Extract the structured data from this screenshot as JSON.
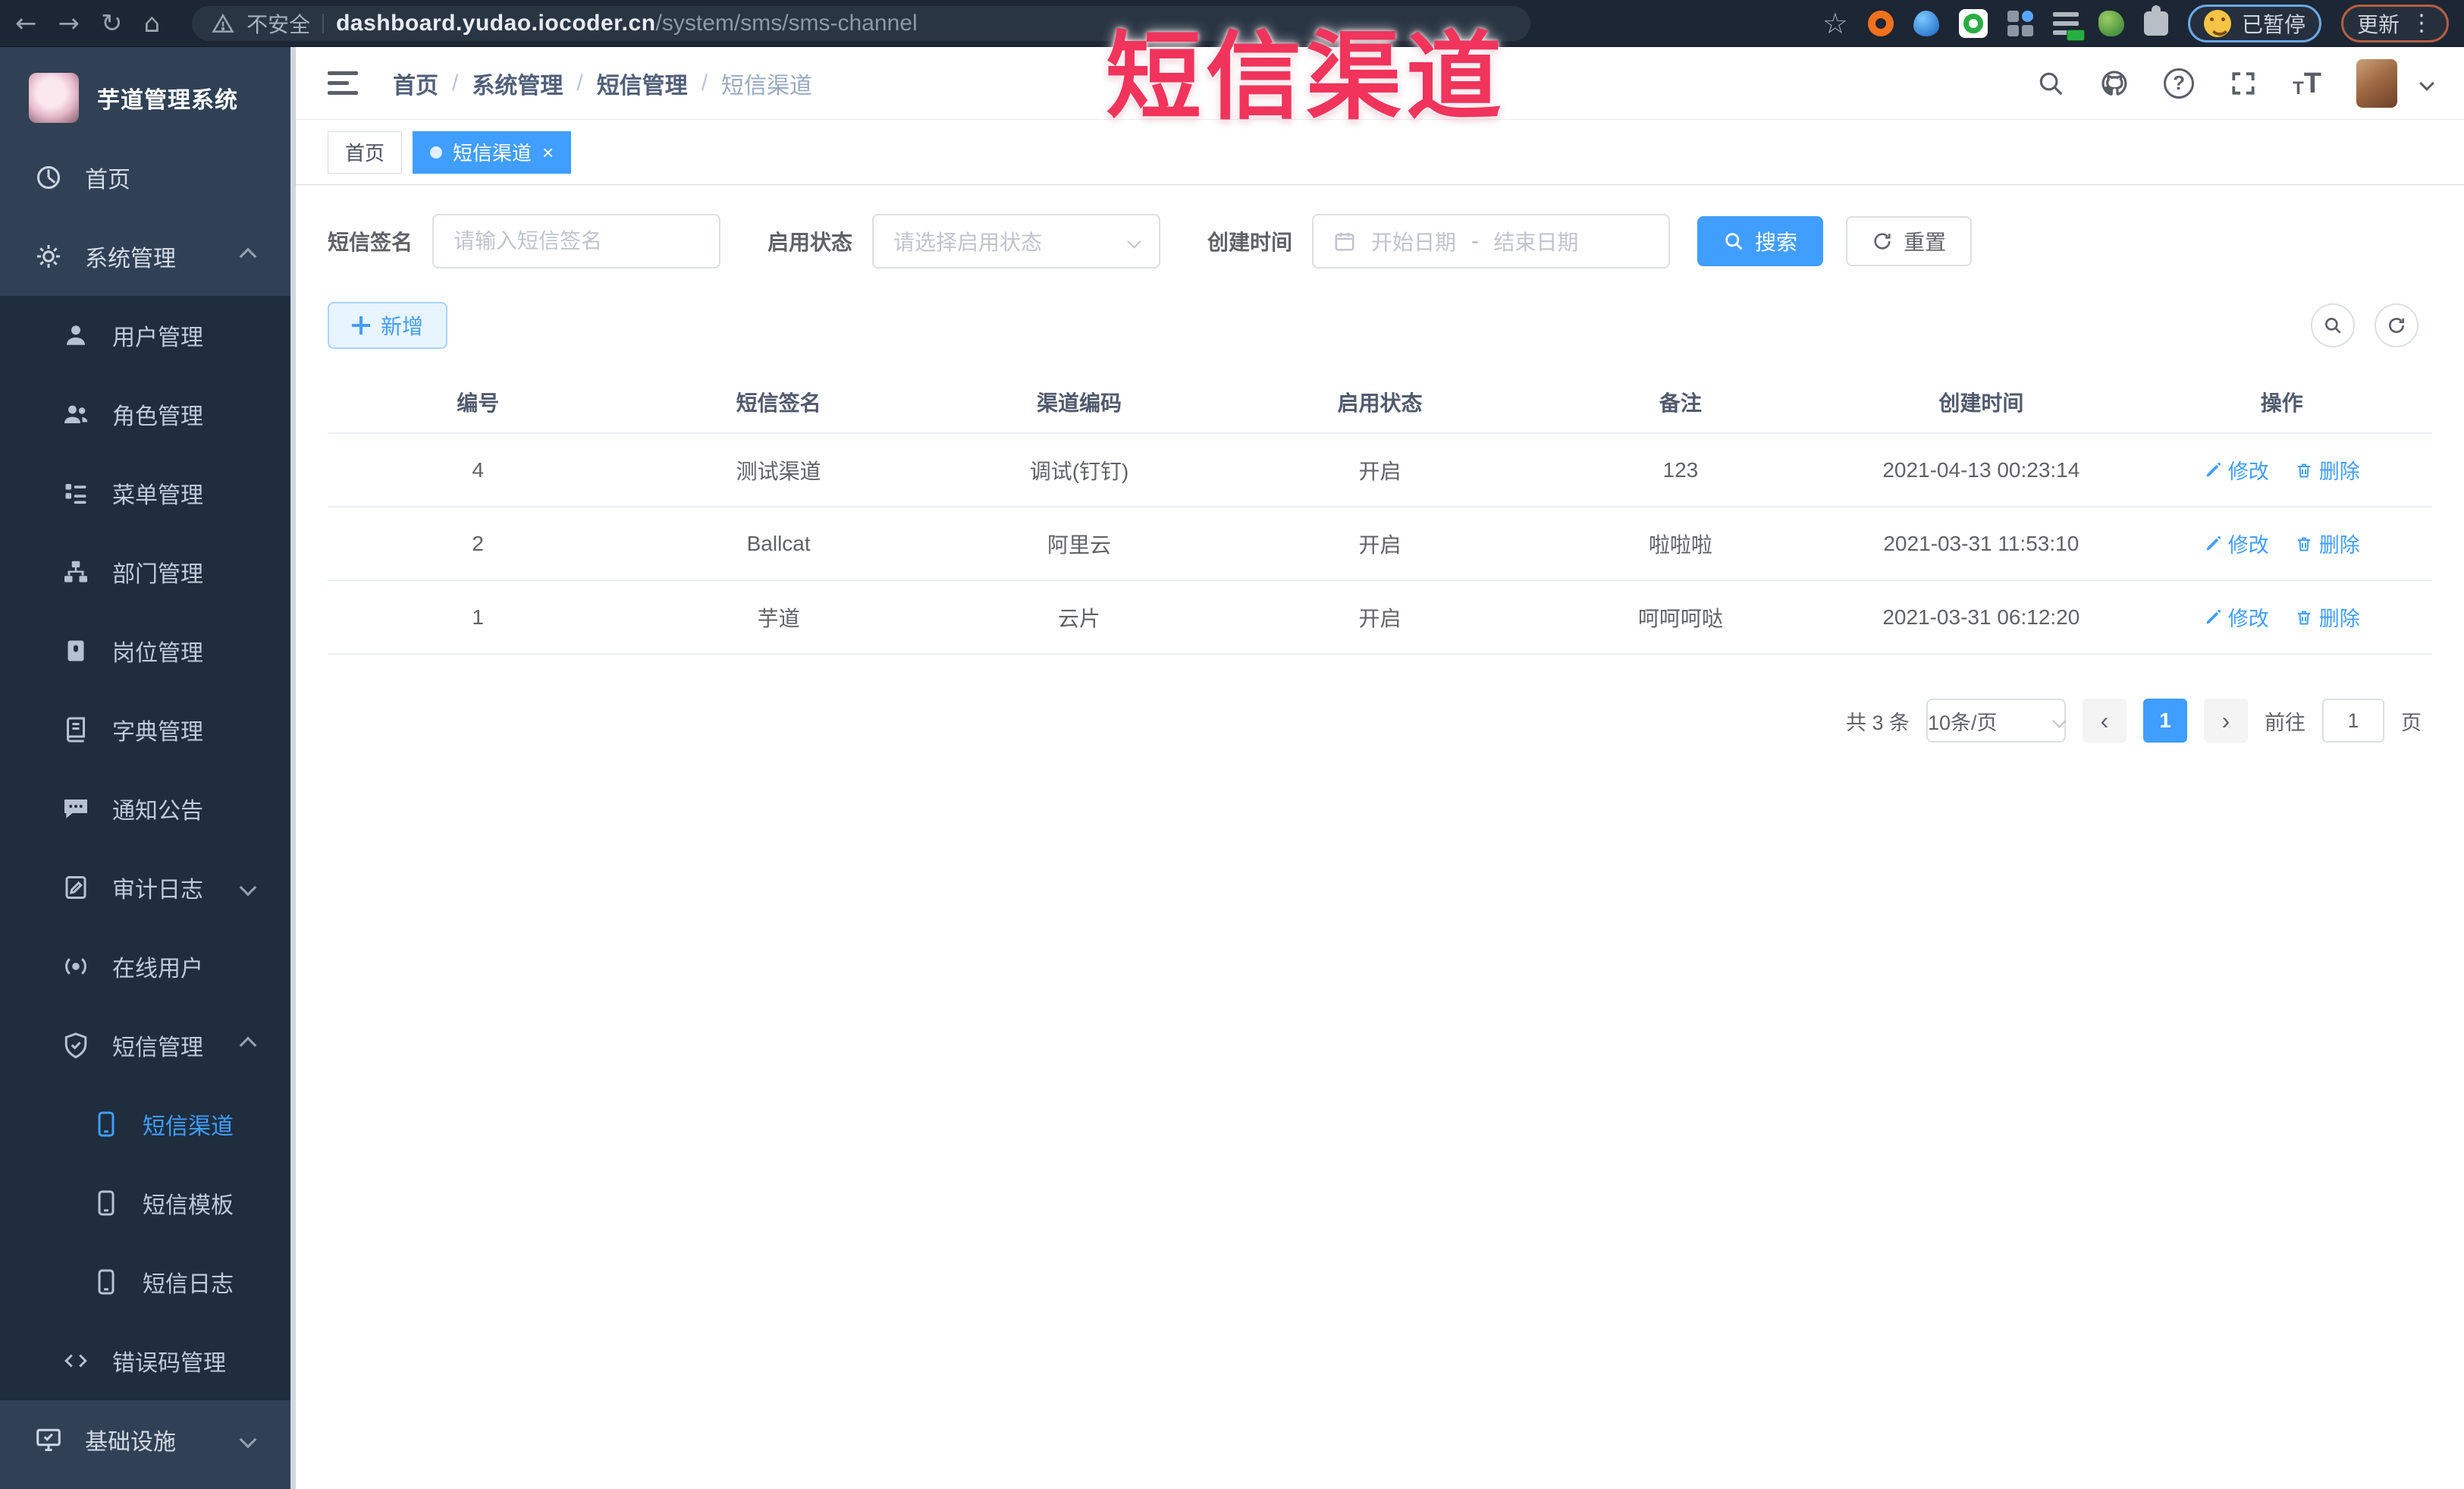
{
  "browser": {
    "security_label": "不安全",
    "url_host": "dashboard.yudao.iocoder.cn",
    "url_path": "/system/sms/sms-channel",
    "paused_label": "已暂停",
    "update_label": "更新",
    "icons": {
      "back": "←",
      "forward": "→",
      "reload": "↻",
      "home": "⌂",
      "star": "☆",
      "overflow": "⋮"
    }
  },
  "overlay": {
    "title": "短信渠道",
    "color": "#f0345c"
  },
  "sidebar": {
    "logo_title": "芋道管理系统",
    "items": [
      {
        "label": "首页",
        "icon": "dashboard-icon",
        "level": 1
      },
      {
        "label": "系统管理",
        "icon": "gear-icon",
        "level": 1,
        "state": "expanded"
      },
      {
        "label": "用户管理",
        "icon": "user-icon",
        "level": 2
      },
      {
        "label": "角色管理",
        "icon": "role-icon",
        "level": 2
      },
      {
        "label": "菜单管理",
        "icon": "menu-icon",
        "level": 2
      },
      {
        "label": "部门管理",
        "icon": "dept-icon",
        "level": 2
      },
      {
        "label": "岗位管理",
        "icon": "post-icon",
        "level": 2
      },
      {
        "label": "字典管理",
        "icon": "dict-icon",
        "level": 2
      },
      {
        "label": "通知公告",
        "icon": "notice-icon",
        "level": 2
      },
      {
        "label": "审计日志",
        "icon": "audit-log-icon",
        "level": 2,
        "state": "collapsed"
      },
      {
        "label": "在线用户",
        "icon": "online-user-icon",
        "level": 2
      },
      {
        "label": "短信管理",
        "icon": "sms-icon",
        "level": 2,
        "state": "expanded"
      },
      {
        "label": "短信渠道",
        "icon": "sms-channel-icon",
        "level": 3,
        "active": true
      },
      {
        "label": "短信模板",
        "icon": "sms-template-icon",
        "level": 3
      },
      {
        "label": "短信日志",
        "icon": "sms-log-icon",
        "level": 3
      },
      {
        "label": "错误码管理",
        "icon": "error-code-icon",
        "level": 2
      },
      {
        "label": "基础设施",
        "icon": "infra-icon",
        "level": 1,
        "state": "collapsed"
      }
    ]
  },
  "header": {
    "breadcrumb": [
      "首页",
      "系统管理",
      "短信管理",
      "短信渠道"
    ],
    "separator": "/",
    "icons": {
      "help": "?",
      "font_big": "T",
      "font_small": "T"
    }
  },
  "tabs": {
    "close_glyph": "×",
    "items": [
      {
        "label": "首页",
        "active": false
      },
      {
        "label": "短信渠道",
        "active": true
      }
    ]
  },
  "filters": {
    "sign_label": "短信签名",
    "sign_placeholder": "请输入短信签名",
    "status_label": "启用状态",
    "status_placeholder": "请选择启用状态",
    "time_label": "创建时间",
    "start_placeholder": "开始日期",
    "range_separator": "-",
    "end_placeholder": "结束日期",
    "search_label": "搜索",
    "reset_label": "重置"
  },
  "toolbar": {
    "add_label": "新增"
  },
  "table": {
    "columns": [
      "编号",
      "短信签名",
      "渠道编码",
      "启用状态",
      "备注",
      "创建时间",
      "操作"
    ],
    "edit_label": "修改",
    "delete_label": "删除",
    "rows": [
      {
        "id": "4",
        "sign": "测试渠道",
        "code": "调试(钉钉)",
        "status": "开启",
        "remark": "123",
        "created": "2021-04-13 00:23:14"
      },
      {
        "id": "2",
        "sign": "Ballcat",
        "code": "阿里云",
        "status": "开启",
        "remark": "啦啦啦",
        "created": "2021-03-31 11:53:10"
      },
      {
        "id": "1",
        "sign": "芋道",
        "code": "云片",
        "status": "开启",
        "remark": "呵呵呵哒",
        "created": "2021-03-31 06:12:20"
      }
    ]
  },
  "pagination": {
    "total_label": "共 3 条",
    "page_size_label": "10条/页",
    "prev_glyph": "‹",
    "next_glyph": "›",
    "current_page": "1",
    "goto_label": "前往",
    "goto_value": "1",
    "page_unit_label": "页"
  },
  "colors": {
    "accent": "#409eff",
    "sidebar_bg": "#304156",
    "submenu_bg": "#1f2d3d",
    "active_tab": "#409eff"
  }
}
